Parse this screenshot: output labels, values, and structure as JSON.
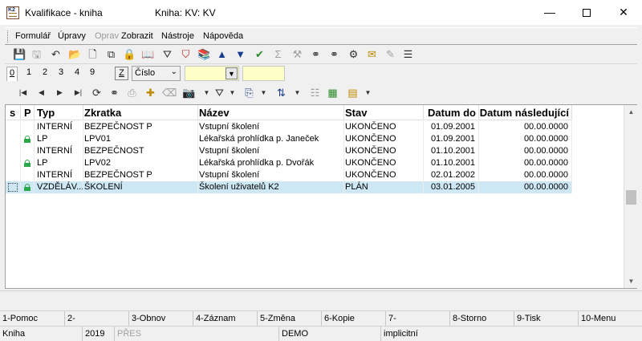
{
  "window": {
    "title": "Kvalifikace - kniha",
    "book_label": "Kniha: KV: KV",
    "minimize_glyph": "—",
    "close_glyph": "✕"
  },
  "menu": {
    "items": [
      {
        "label": "Formulář",
        "enabled": true
      },
      {
        "label": "Úpravy",
        "enabled": true
      },
      {
        "label": "Oprav",
        "enabled": false
      },
      {
        "label": "Zobrazit",
        "enabled": true
      },
      {
        "label": "Nástroje",
        "enabled": true
      },
      {
        "label": "Nápověda",
        "enabled": true
      }
    ]
  },
  "toolbar_icons": [
    "save-icon",
    "save-all-icon",
    "undo-icon",
    "open-folder-icon",
    "new-document-icon",
    "copy-icon",
    "lock-icon",
    "book-icon",
    "filter-icon",
    "delete-filter-icon",
    "books-icon",
    "arrow-up-icon",
    "arrow-down-icon",
    "check-filter-icon",
    "sum-icon",
    "wrench-icon",
    "binoculars-icon",
    "binoculars-next-icon",
    "tools-icon",
    "envelope-icon",
    "edit-icon",
    "menu-lines-icon"
  ],
  "tabs": [
    "0",
    "1",
    "2",
    "3",
    "4",
    "9"
  ],
  "sort": {
    "z_label": "Z",
    "field": "Číslo"
  },
  "nav_icons": [
    "first-record-icon",
    "prev-record-icon",
    "next-record-icon",
    "last-record-icon",
    "refresh-icon",
    "search-icon",
    "add-icon",
    "remove-icon",
    "camera-icon",
    "filter-dropdown-icon",
    "export-icon",
    "sort-icon",
    "columns-icon",
    "excel-icon",
    "notes-icon"
  ],
  "grid": {
    "columns": [
      "s",
      "P",
      "Typ",
      "Zkratka",
      "Název",
      "Stav",
      "Datum do",
      "Datum následující"
    ],
    "rows": [
      {
        "s": "",
        "p": false,
        "typ": "INTERNÍ",
        "zkratka": "BEZPEČNOST P",
        "nazev": "Vstupní školení",
        "stav": "UKONČENO",
        "datum_do": "01.09.2001",
        "datum_nasl": "00.00.0000",
        "selected": false
      },
      {
        "s": "",
        "p": true,
        "typ": "LP",
        "zkratka": "LPV01",
        "nazev": "Lékařská prohlídka p. Janeček",
        "stav": "UKONČENO",
        "datum_do": "01.09.2001",
        "datum_nasl": "00.00.0000",
        "selected": false
      },
      {
        "s": "",
        "p": false,
        "typ": "INTERNÍ",
        "zkratka": "BEZPEČNOST",
        "nazev": "Vstupní školení",
        "stav": "UKONČENO",
        "datum_do": "01.10.2001",
        "datum_nasl": "00.00.0000",
        "selected": false
      },
      {
        "s": "",
        "p": true,
        "typ": "LP",
        "zkratka": "LPV02",
        "nazev": "Lékařská prohlídka p. Dvořák",
        "stav": "UKONČENO",
        "datum_do": "01.10.2001",
        "datum_nasl": "00.00.0000",
        "selected": false
      },
      {
        "s": "",
        "p": false,
        "typ": "INTERNÍ",
        "zkratka": "BEZPEČNOST P",
        "nazev": "Vstupní školení",
        "stav": "UKONČENO",
        "datum_do": "02.01.2002",
        "datum_nasl": "00.00.0000",
        "selected": false
      },
      {
        "s": "",
        "p": true,
        "typ": "VZDĚLÁV...",
        "zkratka": "ŠKOLENÍ",
        "nazev": "Školení uživatelů K2",
        "stav": "PLÁN",
        "datum_do": "03.01.2005",
        "datum_nasl": "00.00.0000",
        "selected": true
      }
    ]
  },
  "fkeys": [
    "1-Pomoc",
    "2-",
    "3-Obnov",
    "4-Záznam",
    "5-Změna",
    "6-Kopie",
    "7-",
    "8-Storno",
    "9-Tisk",
    "10-Menu"
  ],
  "status": {
    "module": "Kniha",
    "year": "2019",
    "mode": "PŘES",
    "user": "DEMO",
    "profile": "implicitní"
  }
}
